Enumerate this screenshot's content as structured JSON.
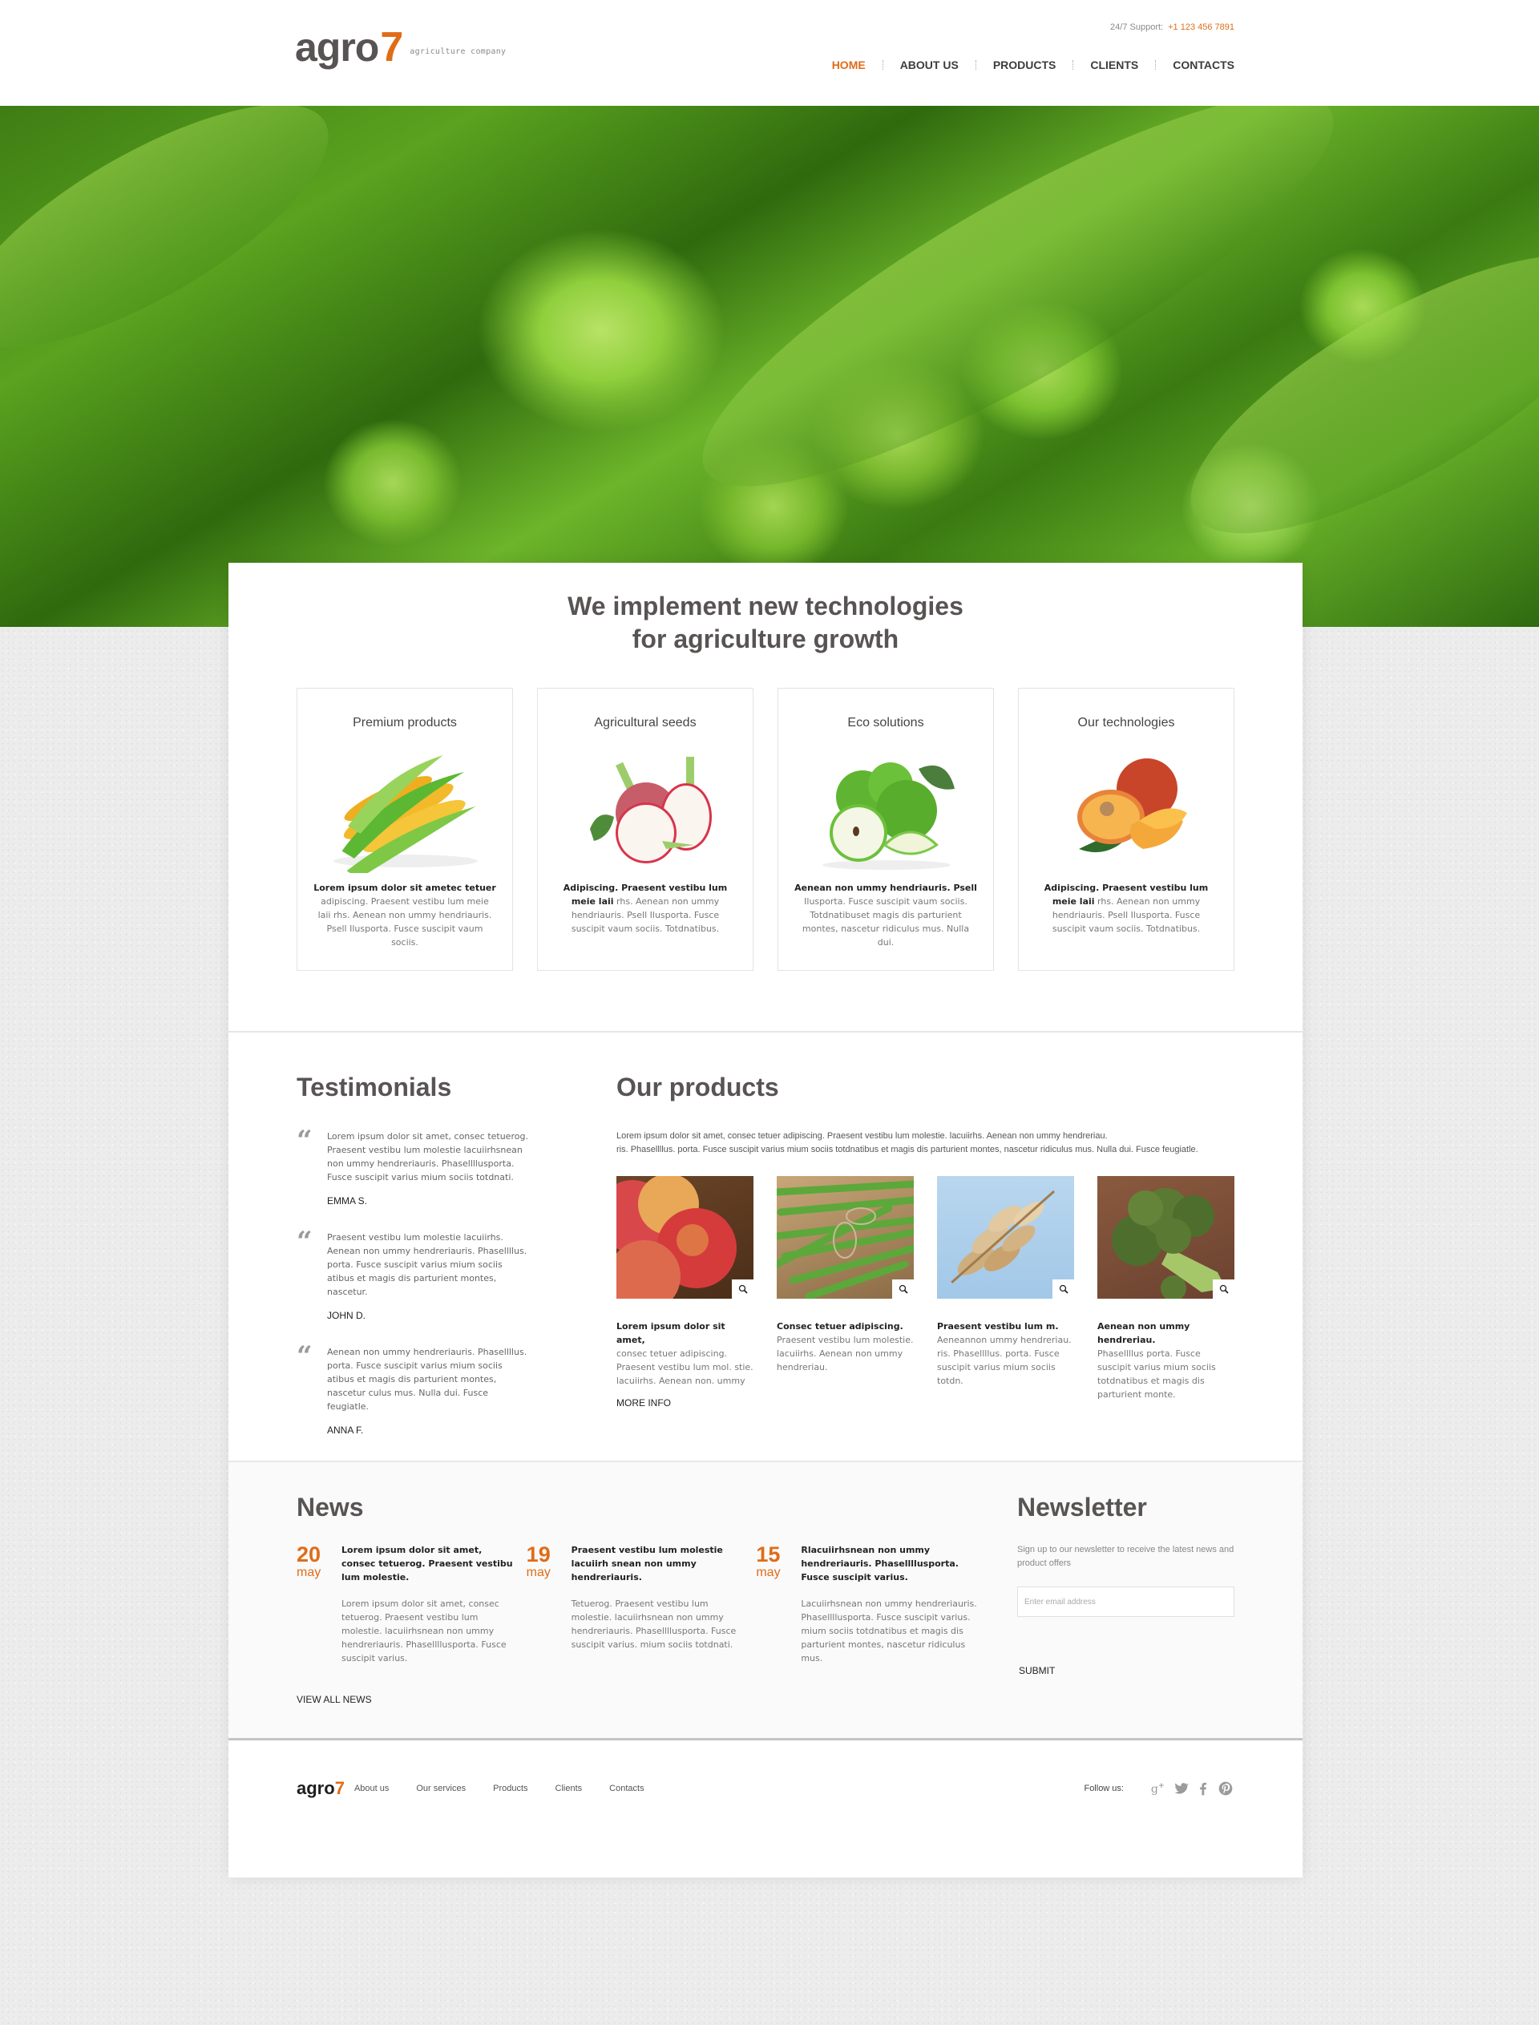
{
  "header": {
    "logo_text": "agro",
    "logo_number": "7",
    "tagline": "agriculture company",
    "support_label": "24/7 Support:",
    "support_phone": "+1 123 456 7891",
    "nav": [
      {
        "label": "HOME",
        "active": true
      },
      {
        "label": "ABOUT US",
        "active": false
      },
      {
        "label": "PRODUCTS",
        "active": false
      },
      {
        "label": "CLIENTS",
        "active": false
      },
      {
        "label": "CONTACTS",
        "active": false
      }
    ]
  },
  "hero": {
    "slides_total": 4,
    "active_slide": 1
  },
  "intro": {
    "title_line1": "We implement new technologies",
    "title_line2": "for agriculture growth"
  },
  "features": [
    {
      "title": "Premium products",
      "image": "corn",
      "lead": "Lorem ipsum dolor sit ametec tetuer",
      "text": "adipiscing. Praesent vestibu lum meie laii rhs. Aenean non ummy hendriauris. Psell Ilusporta. Fusce suscipit vaum sociis."
    },
    {
      "title": "Agricultural seeds",
      "image": "radish",
      "lead": "Adipiscing. Praesent vestibu lum meie laii",
      "text": "rhs. Aenean non ummy hendriauris. Psell Ilusporta. Fusce suscipit vaum sociis. Totdnatibus."
    },
    {
      "title": "Eco solutions",
      "image": "green-apples",
      "lead": "Aenean non ummy hendriauris. Psell",
      "text": "Ilusporta. Fusce suscipit vaum sociis. Totdnatibuset magis dis parturient montes, nascetur ridiculus mus. Nulla dui."
    },
    {
      "title": "Our technologies",
      "image": "peaches",
      "lead": "Adipiscing. Praesent vestibu lum meie laii",
      "text": "rhs. Aenean non ummy hendriauris. Psell Ilusporta. Fusce suscipit vaum sociis. Totdnatibus."
    }
  ],
  "testimonials": {
    "title": "Testimonials",
    "items": [
      {
        "text": "Lorem ipsum dolor sit amet, consec tetuerog. Praesent vestibu lum molestie lacuiirhsnean non ummy hendreriauris. Phasellllusporta. Fusce suscipit varius mium sociis totdnati.",
        "author": "EMMA S."
      },
      {
        "text": "Praesent vestibu lum molestie lacuiirhs. Aenean non ummy hendreriauris. Phasellllus. porta. Fusce suscipit varius mium sociis atibus et magis dis parturient montes, nascetur.",
        "author": "JOHN D."
      },
      {
        "text": "Aenean non ummy hendreriauris. Phasellllus. porta. Fusce suscipit varius mium sociis atibus et magis dis parturient montes, nascetur culus mus. Nulla dui. Fusce feugiatle.",
        "author": "ANNA F."
      }
    ]
  },
  "products": {
    "title": "Our products",
    "intro_line1": "Lorem ipsum dolor sit amet, consec tetuer adipiscing. Praesent vestibu lum molestie. lacuiirhs. Aenean non ummy hendreriau.",
    "intro_line2": "ris. Phasellllus. porta. Fusce suscipit varius mium sociis totdnatibus et magis dis parturient montes, nascetur ridiculus mus. Nulla dui. Fusce feugiatle.",
    "items": [
      {
        "image": "red-apples",
        "lead": "Lorem ipsum dolor sit amet,",
        "text": "consec tetuer adipiscing. Praesent vestibu lum mol. stie. lacuiirhs. Aenean non. ummy"
      },
      {
        "image": "green-beans",
        "lead": "Consec tetuer adipiscing.",
        "text": "Praesent vestibu lum molestie. lacuiirhs. Aenean non ummy hendreriau."
      },
      {
        "image": "wheat",
        "lead": "Praesent vestibu lum m.",
        "text": "Aeneannon ummy hendreriau. ris. Phasellllus. porta. Fusce suscipit varius mium sociis totdn."
      },
      {
        "image": "broccoli",
        "lead": "Aenean non ummy hendreriau.",
        "text": "Phasellllus porta. Fusce suscipit varius mium sociis totdnatibus et magis dis parturient monte."
      }
    ],
    "more_info": "MORE INFO"
  },
  "news": {
    "title": "News",
    "items": [
      {
        "day": "20",
        "month": "may",
        "title": "Lorem ipsum dolor sit amet, consec tetuerog. Praesent vestibu lum molestie.",
        "text": "Lorem ipsum dolor sit amet, consec tetuerog. Praesent vestibu lum molestie. lacuiirhsnean non ummy hendreriauris. Phasellllusporta. Fusce suscipit varius."
      },
      {
        "day": "19",
        "month": "may",
        "title": "Praesent vestibu lum molestie lacuiirh snean non ummy hendreriauris.",
        "text": "Tetuerog. Praesent vestibu lum molestie. lacuiirhsnean non ummy hendreriauris. Phasellllusporta. Fusce suscipit varius. mium sociis totdnati."
      },
      {
        "day": "15",
        "month": "may",
        "title": "Rlacuiirhsnean non ummy hendreriauris. Phasellllusporta. Fusce suscipit varius.",
        "text": "Lacuiirhsnean non ummy hendreriauris. Phasellllusporta. Fusce suscipit varius. mium sociis totdnatibus et magis dis parturient montes, nascetur ridiculus mus."
      }
    ],
    "view_all": "VIEW ALL NEWS"
  },
  "newsletter": {
    "title": "Newsletter",
    "text": "Sign up to our newsletter to receive the latest news and product offers",
    "email_placeholder": "Enter email address",
    "email_value": "",
    "submit": "SUBMIT"
  },
  "footer": {
    "logo_text": "agro",
    "logo_number": "7",
    "links": [
      "About us",
      "Our services",
      "Products",
      "Clients",
      "Contacts"
    ],
    "follow_label": "Follow us:",
    "social": [
      "google-plus",
      "twitter",
      "facebook",
      "pinterest"
    ]
  },
  "colors": {
    "accent": "#e06c17",
    "heading": "#595454",
    "page_bg": "#ececec"
  }
}
